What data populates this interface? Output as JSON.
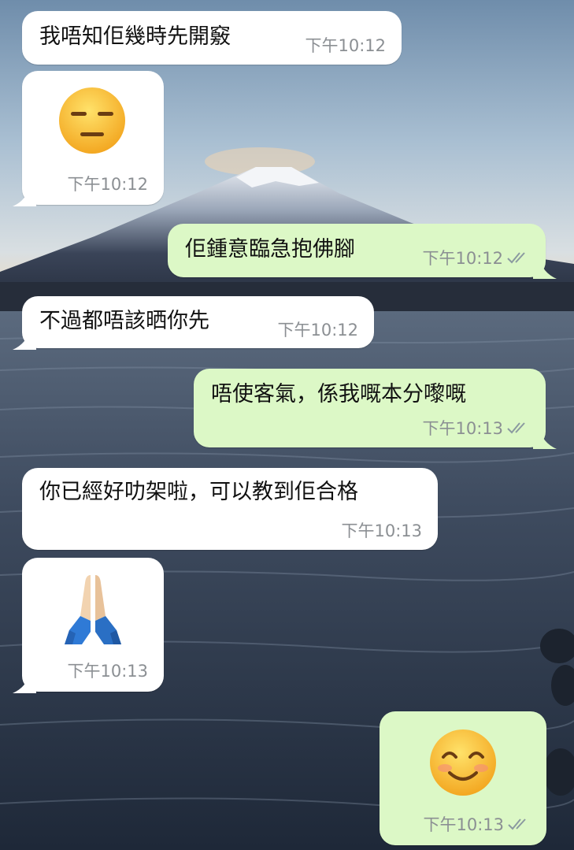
{
  "messages": [
    {
      "dir": "in",
      "text": "我唔知佢幾時先開竅",
      "time": "下午10:12"
    },
    {
      "dir": "in",
      "emoji": "expressionless-face",
      "time": "下午10:12"
    },
    {
      "dir": "out",
      "text": "佢鍾意臨急抱佛腳",
      "time": "下午10:12",
      "status": "read"
    },
    {
      "dir": "in",
      "text": "不過都唔該晒你先",
      "time": "下午10:12"
    },
    {
      "dir": "out",
      "text": "唔使客氣，係我嘅本分嚟嘅",
      "time": "下午10:13",
      "status": "read"
    },
    {
      "dir": "in",
      "text": "你已經好叻架啦，可以教到佢合格",
      "time": "下午10:13"
    },
    {
      "dir": "in",
      "emoji": "folded-hands",
      "time": "下午10:13"
    },
    {
      "dir": "out",
      "emoji": "smiling-face-with-smiling-eyes",
      "time": "下午10:13",
      "status": "read"
    }
  ],
  "colors": {
    "incoming_bubble": "#ffffff",
    "outgoing_bubble": "#dcf8c6",
    "timestamp": "#8b8f93",
    "ticks": "#8b9aa0"
  },
  "wallpaper": "mountain-lake-icon"
}
